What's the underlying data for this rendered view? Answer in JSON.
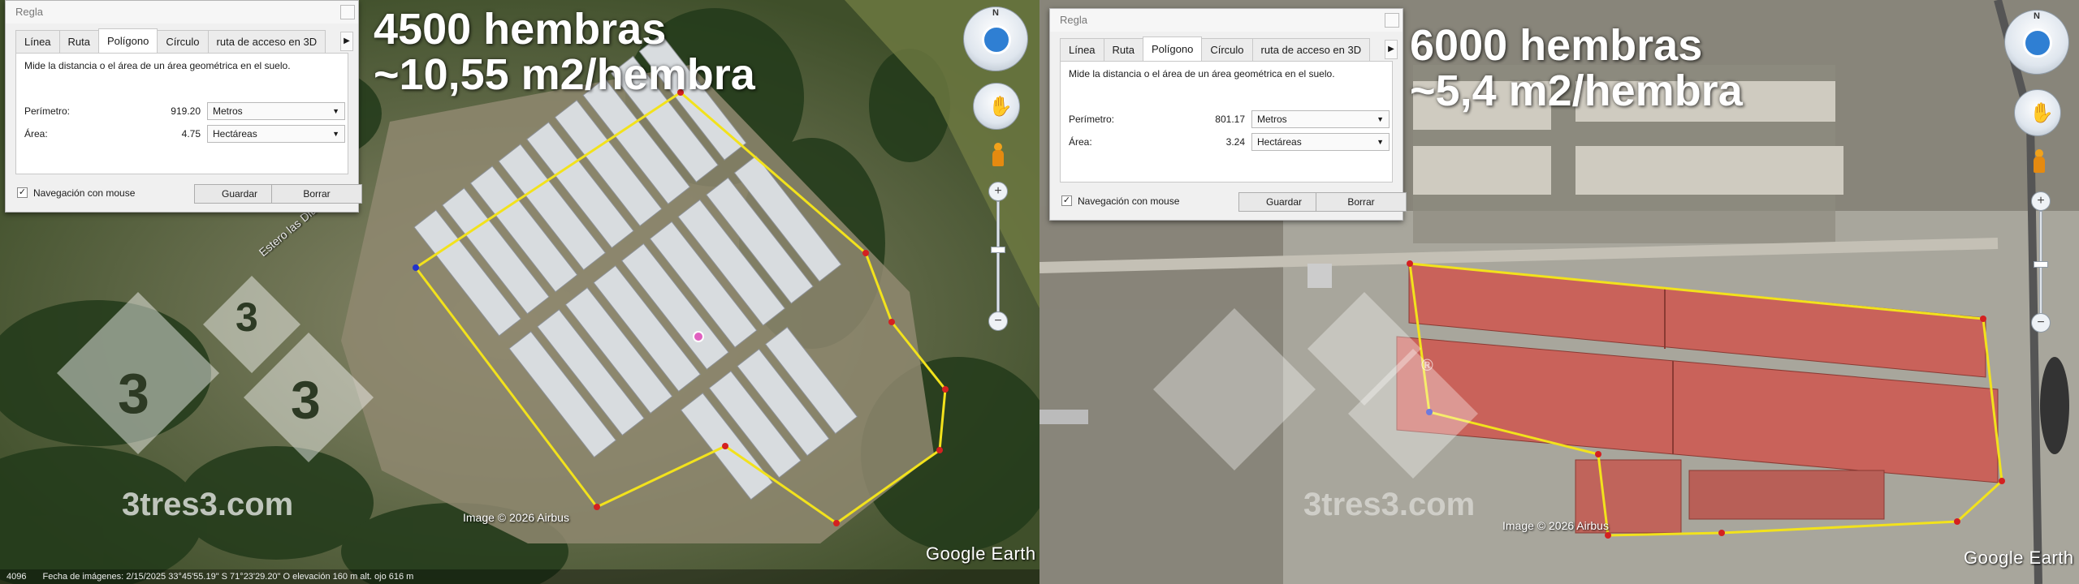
{
  "colors": {
    "polygon_line": "#f2e21c",
    "vertex": "#d42020",
    "start_vertex": "#2233cc",
    "tab_active_bg": "#ffffff",
    "dialog_bg": "#f0f0f0",
    "roof_red": "#c9625a",
    "roof_gray": "#d7dbe0"
  },
  "left": {
    "headline_line1": "4500 hembras",
    "headline_line2": "~10,55 m2/hembra",
    "ruler": {
      "title": "Regla",
      "tabs": [
        "Línea",
        "Ruta",
        "Polígono",
        "Círculo",
        "ruta de acceso en 3D"
      ],
      "active_tab": "Polígono",
      "description": "Mide la distancia o el área de un área geométrica en el suelo.",
      "perimeter_label": "Perímetro:",
      "perimeter_value": "919.20",
      "perimeter_unit": "Metros",
      "area_label": "Área:",
      "area_value": "4.75",
      "area_unit": "Hectáreas",
      "mouse_nav_label": "Navegación con mouse",
      "mouse_nav_checked": "✓",
      "save_label": "Guardar",
      "clear_label": "Borrar"
    },
    "nav_north": "N",
    "map_label_stream": "Estero las Diucas",
    "image_credit": "Image © 2026 Airbus",
    "google_earth": "Google Earth",
    "watermark": "3tres3.com",
    "watermark_mark": "3",
    "status_bar": "Fecha de imágenes: 2/15/2025     33°45'55.19\" S   71°23'29.20\" O  elevación  160 m    alt. ojo  616 m",
    "status_scale": "4096"
  },
  "right": {
    "headline_line1": "6000 hembras",
    "headline_line2": "~5,4 m2/hembra",
    "ruler": {
      "title": "Regla",
      "tabs": [
        "Línea",
        "Ruta",
        "Polígono",
        "Círculo",
        "ruta de acceso en 3D"
      ],
      "active_tab": "Polígono",
      "description": "Mide la distancia o el área de un área geométrica en el suelo.",
      "perimeter_label": "Perímetro:",
      "perimeter_value": "801.17",
      "perimeter_unit": "Metros",
      "area_label": "Área:",
      "area_value": "3.24",
      "area_unit": "Hectáreas",
      "mouse_nav_label": "Navegación con mouse",
      "mouse_nav_checked": "✓",
      "save_label": "Guardar",
      "clear_label": "Borrar"
    },
    "nav_north": "N",
    "image_credit": "Image © 2026 Airbus",
    "google_earth": "Google Earth",
    "watermark": "3tres3.com",
    "registered": "®"
  }
}
